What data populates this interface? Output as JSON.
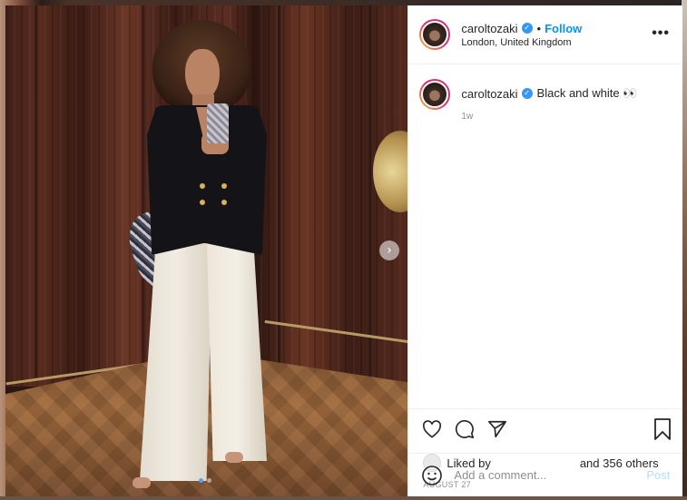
{
  "post": {
    "username": "caroltozaki",
    "verified": true,
    "bullet": "•",
    "follow_label": "Follow",
    "location": "London, United Kingdom",
    "more_icon": "more-horizontal-icon",
    "caption": {
      "username": "caroltozaki",
      "text": "Black and white 👀",
      "time": "1w"
    },
    "likes": {
      "prefix": "Liked by",
      "suffix": "and 356 others"
    },
    "date": "AUGUST 27",
    "comment": {
      "placeholder": "Add a comment...",
      "post_label": "Post"
    },
    "carousel": {
      "count": 2,
      "active_index": 0,
      "next_icon": "chevron-right-icon"
    }
  },
  "icons": {
    "like": "heart-icon",
    "comment": "comment-icon",
    "share": "paper-plane-icon",
    "save": "bookmark-icon",
    "emoji": "emoji-icon",
    "verified": "verified-badge-icon"
  },
  "colors": {
    "accent": "#0095f6",
    "post_disabled": "#b2dffc",
    "verified": "#3897f0",
    "muted": "#8e8e8e",
    "text": "#262626"
  }
}
